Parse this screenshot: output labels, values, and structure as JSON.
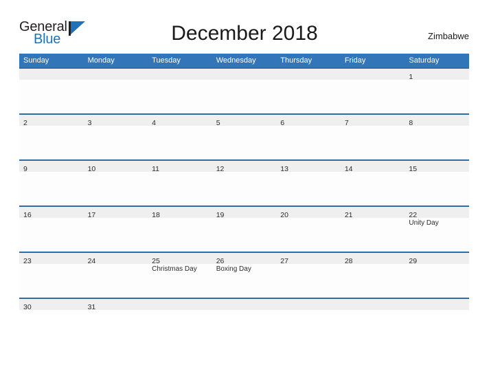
{
  "brand": {
    "word_one": "General",
    "word_two": "Blue",
    "flag_icon": "flag-triangle-icon",
    "accent_color": "#2072b8"
  },
  "header": {
    "title": "December 2018",
    "country": "Zimbabwe"
  },
  "theme": {
    "header_blue": "#3375b9",
    "rule_blue": "#2d6ca7",
    "band_gray": "#efefef",
    "text_dark": "#2b2b2b"
  },
  "calendar": {
    "weekday_headers": [
      "Sunday",
      "Monday",
      "Tuesday",
      "Wednesday",
      "Thursday",
      "Friday",
      "Saturday"
    ],
    "weeks": [
      [
        {
          "day": ""
        },
        {
          "day": ""
        },
        {
          "day": ""
        },
        {
          "day": ""
        },
        {
          "day": ""
        },
        {
          "day": ""
        },
        {
          "day": "1",
          "event": ""
        }
      ],
      [
        {
          "day": "2",
          "event": ""
        },
        {
          "day": "3",
          "event": ""
        },
        {
          "day": "4",
          "event": ""
        },
        {
          "day": "5",
          "event": ""
        },
        {
          "day": "6",
          "event": ""
        },
        {
          "day": "7",
          "event": ""
        },
        {
          "day": "8",
          "event": ""
        }
      ],
      [
        {
          "day": "9",
          "event": ""
        },
        {
          "day": "10",
          "event": ""
        },
        {
          "day": "11",
          "event": ""
        },
        {
          "day": "12",
          "event": ""
        },
        {
          "day": "13",
          "event": ""
        },
        {
          "day": "14",
          "event": ""
        },
        {
          "day": "15",
          "event": ""
        }
      ],
      [
        {
          "day": "16",
          "event": ""
        },
        {
          "day": "17",
          "event": ""
        },
        {
          "day": "18",
          "event": ""
        },
        {
          "day": "19",
          "event": ""
        },
        {
          "day": "20",
          "event": ""
        },
        {
          "day": "21",
          "event": ""
        },
        {
          "day": "22",
          "event": "Unity Day"
        }
      ],
      [
        {
          "day": "23",
          "event": ""
        },
        {
          "day": "24",
          "event": ""
        },
        {
          "day": "25",
          "event": "Christmas Day"
        },
        {
          "day": "26",
          "event": "Boxing Day"
        },
        {
          "day": "27",
          "event": ""
        },
        {
          "day": "28",
          "event": ""
        },
        {
          "day": "29",
          "event": ""
        }
      ],
      [
        {
          "day": "30",
          "event": ""
        },
        {
          "day": "31",
          "event": ""
        },
        {
          "day": ""
        },
        {
          "day": ""
        },
        {
          "day": ""
        },
        {
          "day": ""
        },
        {
          "day": ""
        }
      ]
    ]
  }
}
